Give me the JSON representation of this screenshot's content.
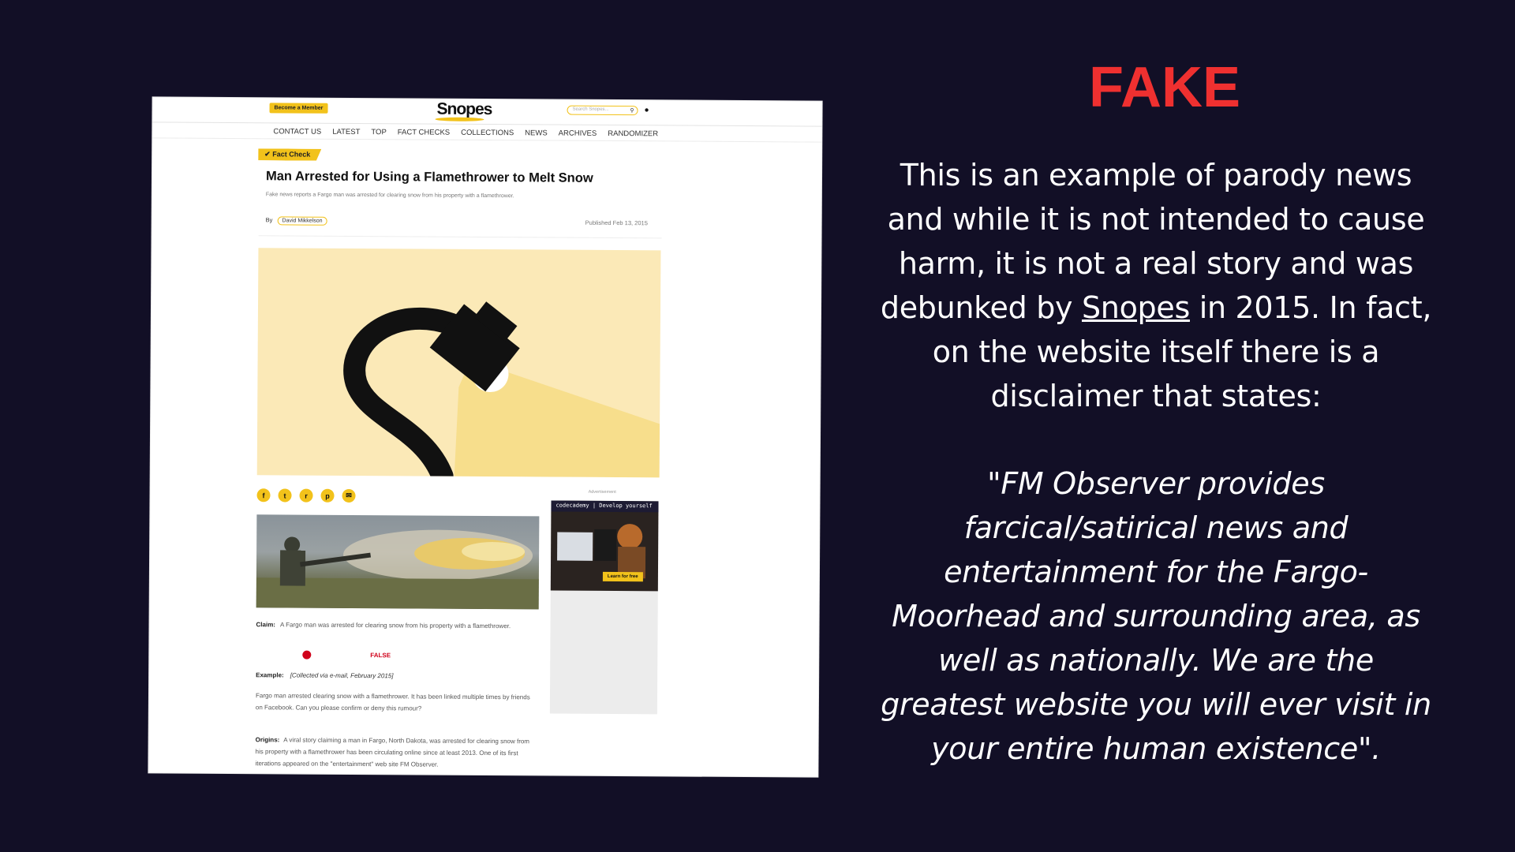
{
  "snopes": {
    "member_label": "Become a Member",
    "logo": "Snopes",
    "search_placeholder": "Search Snopes...",
    "nav": [
      "CONTACT US",
      "LATEST",
      "TOP",
      "FACT CHECKS",
      "COLLECTIONS",
      "NEWS",
      "ARCHIVES",
      "RANDOMIZER"
    ],
    "tag": "Fact Check",
    "title": "Man Arrested for Using a Flamethrower to Melt Snow",
    "subtitle": "Fake news reports a Fargo man was arrested for clearing snow from his property with a flamethrower.",
    "by_label": "By",
    "author": "David Mikkelson",
    "published": "Published Feb 13, 2015",
    "claim_label": "Claim:",
    "claim_text": "A Fargo man was arrested for clearing snow from his property with a flamethrower.",
    "rating": "FALSE",
    "example_label": "Example:",
    "example_text": "[Collected via e-mail, February 2015]",
    "example_body": "Fargo man arrested clearing snow with a flamethrower. It has been linked multiple times by friends on Facebook. Can you please confirm or deny this rumour?",
    "origins_label": "Origins:",
    "origins_text": "A viral story claiming a man in Fargo, North Dakota, was arrested for clearing snow from his property with a flamethrower has been circulating online since at least 2013. One of its first iterations appeared on the \"entertainment\" web site FM Observer.",
    "ad_label": "Advertisement",
    "ad_header": "codecademy | Develop yourself",
    "ad_cta": "Learn for free",
    "share_icons": [
      "facebook-icon",
      "twitter-icon",
      "reddit-icon",
      "pinterest-icon",
      "email-icon"
    ]
  },
  "panel": {
    "verdict": "FAKE",
    "verdict_color": "#ef3030",
    "explain_before": "This is an example of parody news and while it is not intended to cause harm, it is not a real story and was debunked by ",
    "explain_link": "Snopes",
    "explain_after": " in 2015. In fact, on the website itself there is a disclaimer that states:",
    "quote": "\"FM Observer provides farcical/satirical news and entertainment for the Fargo-Moorhead and surrounding area, as well as nationally. We are the greatest website you will ever visit in your entire human existence\"."
  },
  "colors": {
    "background": "#120f26",
    "snopes_yellow": "#f2c21b",
    "false_red": "#d0021b"
  }
}
